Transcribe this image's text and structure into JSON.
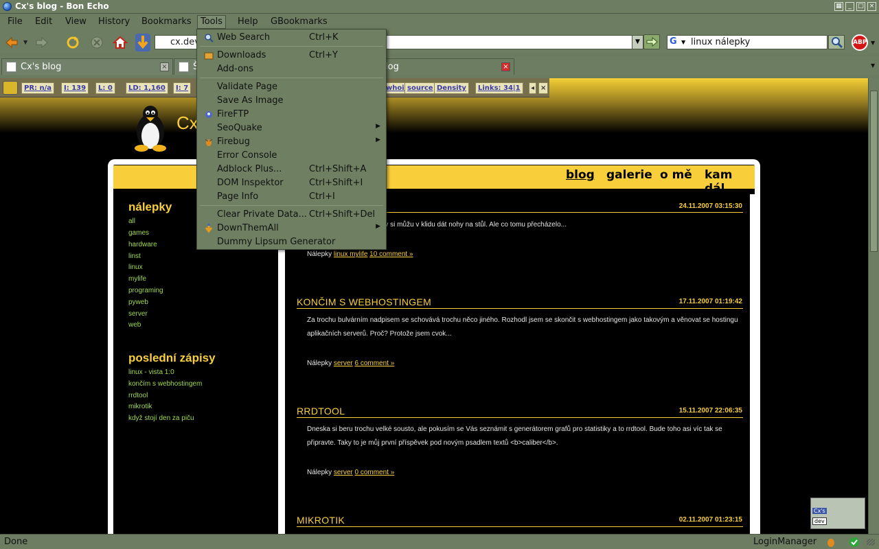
{
  "window": {
    "title": "Cx's blog - Bon Echo"
  },
  "menubar": [
    "File",
    "Edit",
    "View",
    "History",
    "Bookmarks",
    "Tools",
    "Help",
    "GBookmarks"
  ],
  "urlbar": {
    "value": "cx.dev"
  },
  "search": {
    "value": "linux nálepky"
  },
  "abp_label": "ABP",
  "tabs": [
    {
      "label": "Cx's blog"
    },
    {
      "label": "Š"
    },
    {
      "label": "log"
    }
  ],
  "seobar": {
    "pr": "PR: n/a",
    "i": "I: 139",
    "l": "L: 0",
    "ld": "LD: 1,160",
    "d": "I: 7",
    "whois": "whois",
    "source": "source",
    "density": "Density",
    "links": "Links: 34|1"
  },
  "tools_menu": [
    {
      "label": "Web Search",
      "accel": "Ctrl+K"
    },
    {
      "label": "Downloads",
      "accel": "Ctrl+Y"
    },
    {
      "label": "Add-ons",
      "accel": ""
    },
    {
      "label": "Validate Page",
      "accel": ""
    },
    {
      "label": "Save As Image",
      "accel": ""
    },
    {
      "label": "FireFTP",
      "accel": ""
    },
    {
      "label": "SeoQuake",
      "accel": ""
    },
    {
      "label": "Firebug",
      "accel": ""
    },
    {
      "label": "Error Console",
      "accel": ""
    },
    {
      "label": "Adblock Plus...",
      "accel": "Ctrl+Shift+A"
    },
    {
      "label": "DOM Inspektor",
      "accel": "Ctrl+Shift+I"
    },
    {
      "label": "Page Info",
      "accel": "Ctrl+I"
    },
    {
      "label": "Clear Private Data...",
      "accel": "Ctrl+Shift+Del"
    },
    {
      "label": "DownThemAll",
      "accel": ""
    },
    {
      "label": "Dummy Lipsum Generator",
      "accel": ""
    }
  ],
  "site": {
    "title": "Cx's",
    "nav": [
      "blog",
      "galerie",
      "o mě",
      "kam dál"
    ],
    "sidebar": {
      "tags_heading": "nálepky",
      "tags": [
        "all",
        "games",
        "hardware",
        "linst",
        "linux",
        "mylife",
        "programing",
        "pyweb",
        "server",
        "web"
      ],
      "recent_heading": "poslední zápisy",
      "recent": [
        "linux - vista 1:0",
        "končím s webhostingem",
        "rrdtool",
        "mikrotik",
        "když stojí den za piču"
      ]
    },
    "posts": [
      {
        "title": "",
        "date": "24.11.2007 03:15:30",
        "body": "...nech dostal do stavu kdy si můžu v klidu dát nohy na stůl. Ale co tomu přecházelo...",
        "tags_label": "Nálepky",
        "tags": "linux mylife",
        "comments": "10 comment »"
      },
      {
        "title": "KONČIM S WEBHOSTINGEM",
        "date": "17.11.2007 01:19:42",
        "body": "Za trochu bulvárním nadpisem se schovává trochu něco jiného. Rozhodl jsem se skončit s webhostingem jako takovým a věnovat se hostingu aplikačních serverů. Proč? Protože jsem cvok...",
        "tags_label": "Nálepky",
        "tags": "server",
        "comments": "6 comment »"
      },
      {
        "title": "RRDTOOL",
        "date": "15.11.2007 22:06:35",
        "body": "Dneska si beru trochu velké sousto, ale pokusím se Vás seznámit s generátorem grafů pro statistiky a to rrdtool. Bude toho asi víc tak se připravte. Taky to je můj první příspěvek pod novým psadlem textů <b>caliber</b>.",
        "tags_label": "Nálepky",
        "tags": "server",
        "comments": "0 comment »"
      },
      {
        "title": "MIKROTIK",
        "date": "02.11.2007 01:23:15",
        "body": "",
        "tags_label": "",
        "tags": "",
        "comments": ""
      }
    ]
  },
  "status": {
    "text": "Done",
    "login_manager": "LoginManager"
  },
  "thumb": {
    "line1": "Cx's",
    "line2": "dev"
  }
}
